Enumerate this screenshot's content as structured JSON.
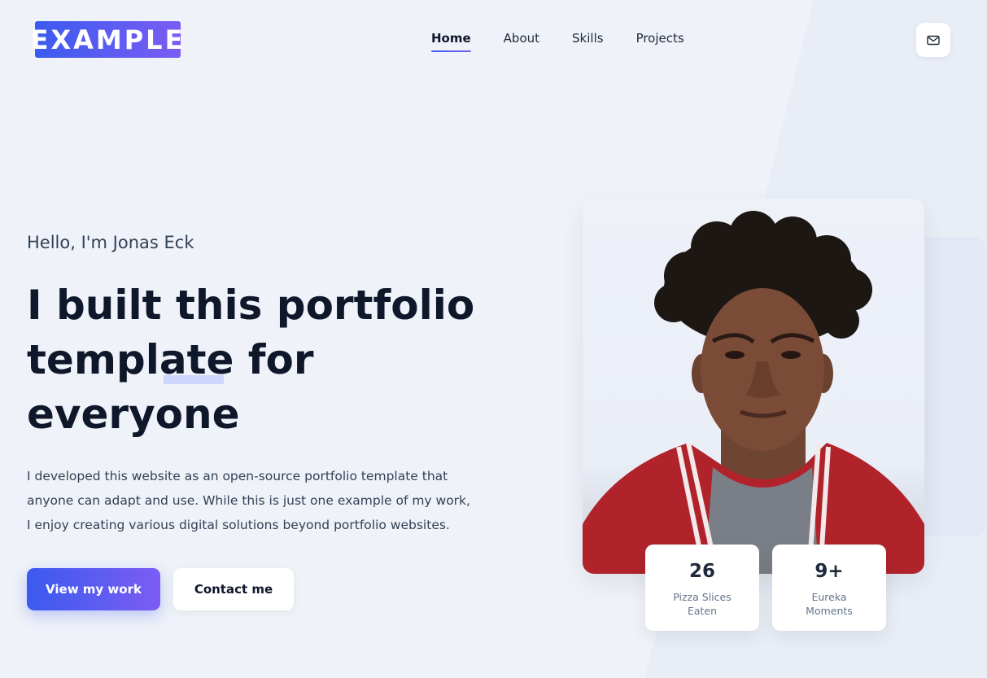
{
  "header": {
    "logo_text": "EXAMPLE",
    "nav": [
      {
        "label": "Home",
        "active": true
      },
      {
        "label": "About",
        "active": false
      },
      {
        "label": "Skills",
        "active": false
      },
      {
        "label": "Projects",
        "active": false
      }
    ],
    "contact_icon": "mail-icon"
  },
  "hero": {
    "greeting": "Hello, I'm Jonas Eck",
    "headline": "I built this portfolio template for everyone",
    "description": "I developed this website as an open-source portfolio template that anyone can adapt and use. While this is just one example of my work, I enjoy creating various digital solutions beyond portfolio websites.",
    "primary_button": "View my work",
    "secondary_button": "Contact me"
  },
  "stats": [
    {
      "value": "26",
      "label": "Pizza Slices Eaten"
    },
    {
      "value": "9+",
      "label": "Eureka Moments"
    }
  ],
  "colors": {
    "accent_start": "#3b5bef",
    "accent_end": "#7b5cf3",
    "background": "#eff2f8",
    "text_dark": "#0f172a"
  }
}
